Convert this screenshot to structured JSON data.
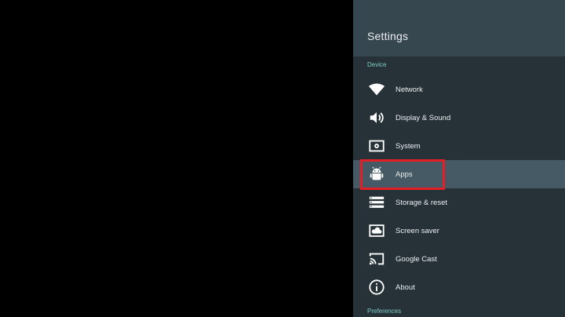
{
  "settings": {
    "title": "Settings",
    "section_device": "Device",
    "section_preferences": "Preferences",
    "items": [
      {
        "label": "Network",
        "icon": "wifi-icon"
      },
      {
        "label": "Display & Sound",
        "icon": "speaker-icon"
      },
      {
        "label": "System",
        "icon": "system-icon"
      },
      {
        "label": "Apps",
        "icon": "android-icon",
        "selected": true
      },
      {
        "label": "Storage & reset",
        "icon": "storage-icon"
      },
      {
        "label": "Screen saver",
        "icon": "screen-saver-icon"
      },
      {
        "label": "Google Cast",
        "icon": "cast-icon"
      },
      {
        "label": "About",
        "icon": "info-icon"
      }
    ]
  },
  "colors": {
    "panel_bg": "#263238",
    "header_bg": "#37474f",
    "selected_bg": "#455a64",
    "section_label": "#80cbc4",
    "highlight": "#e31e24"
  }
}
